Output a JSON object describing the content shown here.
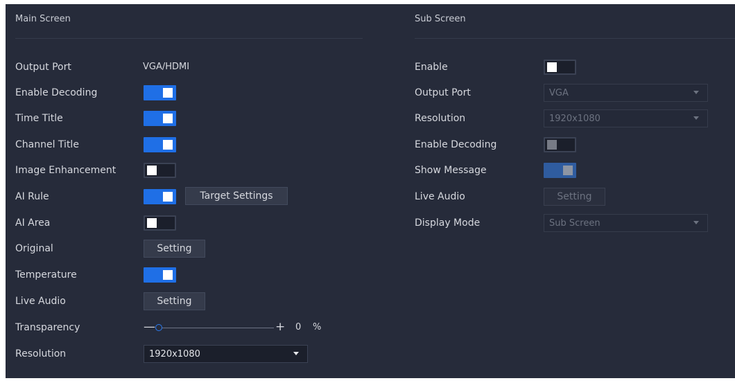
{
  "main": {
    "title": "Main Screen",
    "output_port": {
      "label": "Output Port",
      "value": "VGA/HDMI"
    },
    "enable_decoding": {
      "label": "Enable Decoding",
      "state": "on"
    },
    "time_title": {
      "label": "Time Title",
      "state": "on"
    },
    "channel_title": {
      "label": "Channel Title",
      "state": "on"
    },
    "image_enhancement": {
      "label": "Image Enhancement",
      "state": "off"
    },
    "ai_rule": {
      "label": "AI Rule",
      "state": "on",
      "button": "Target Settings"
    },
    "ai_area": {
      "label": "AI Area",
      "state": "off"
    },
    "original": {
      "label": "Original",
      "button": "Setting"
    },
    "temperature": {
      "label": "Temperature",
      "state": "on"
    },
    "live_audio": {
      "label": "Live Audio",
      "button": "Setting"
    },
    "transparency": {
      "label": "Transparency",
      "minus": "—",
      "plus": "+",
      "value": "0",
      "unit": "%",
      "level": 0
    },
    "resolution": {
      "label": "Resolution",
      "value": "1920x1080"
    }
  },
  "sub": {
    "title": "Sub Screen",
    "enable": {
      "label": "Enable",
      "state": "off"
    },
    "output_port": {
      "label": "Output Port",
      "value": "VGA",
      "disabled": true
    },
    "resolution": {
      "label": "Resolution",
      "value": "1920x1080",
      "disabled": true
    },
    "enable_decoding": {
      "label": "Enable Decoding",
      "state": "off",
      "disabled": true
    },
    "show_message": {
      "label": "Show Message",
      "state": "on",
      "disabled": true
    },
    "live_audio": {
      "label": "Live Audio",
      "button": "Setting",
      "disabled": true
    },
    "display_mode": {
      "label": "Display Mode",
      "value": "Sub Screen",
      "disabled": true
    }
  },
  "colors": {
    "background": "#262b3a",
    "accent": "#1f6fe6",
    "text": "#d6d8de"
  }
}
